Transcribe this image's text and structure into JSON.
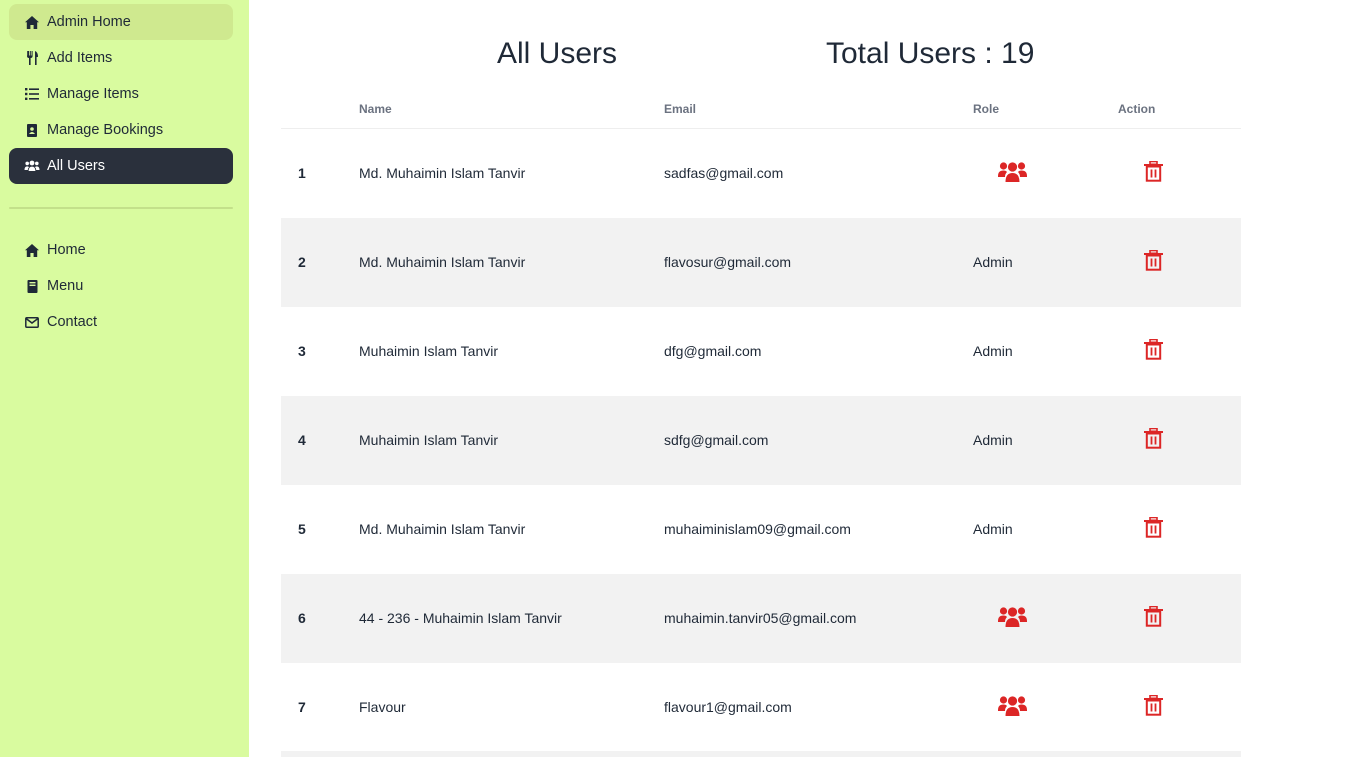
{
  "sidebar": {
    "items": [
      {
        "label": "Admin Home",
        "icon": "home-icon"
      },
      {
        "label": "Add Items",
        "icon": "utensils-icon"
      },
      {
        "label": "Manage Items",
        "icon": "list-icon"
      },
      {
        "label": "Manage Bookings",
        "icon": "book-icon"
      },
      {
        "label": "All Users",
        "icon": "users-icon"
      }
    ],
    "bottom_items": [
      {
        "label": "Home",
        "icon": "home-icon"
      },
      {
        "label": "Menu",
        "icon": "menu-book-icon"
      },
      {
        "label": "Contact",
        "icon": "mail-icon"
      }
    ]
  },
  "header": {
    "title": "All Users",
    "total": "Total Users : 19"
  },
  "table": {
    "columns": [
      "Name",
      "Email",
      "Role",
      "Action"
    ],
    "rows": [
      {
        "index": "1",
        "name": "Md. Muhaimin Islam Tanvir",
        "email": "sadfas@gmail.com",
        "role": ""
      },
      {
        "index": "2",
        "name": "Md. Muhaimin Islam Tanvir",
        "email": "flavosur@gmail.com",
        "role": "Admin"
      },
      {
        "index": "3",
        "name": "Muhaimin Islam Tanvir",
        "email": "dfg@gmail.com",
        "role": "Admin"
      },
      {
        "index": "4",
        "name": "Muhaimin Islam Tanvir",
        "email": "sdfg@gmail.com",
        "role": "Admin"
      },
      {
        "index": "5",
        "name": "Md. Muhaimin Islam Tanvir",
        "email": "muhaiminislam09@gmail.com",
        "role": "Admin"
      },
      {
        "index": "6",
        "name": "44 - 236 - Muhaimin Islam Tanvir",
        "email": "muhaimin.tanvir05@gmail.com",
        "role": ""
      },
      {
        "index": "7",
        "name": "Flavour",
        "email": "flavour1@gmail.com",
        "role": ""
      }
    ]
  },
  "colors": {
    "sidebar_bg": "#d9fb9f",
    "active_bg": "#2a303c",
    "danger": "#dc2626",
    "row_alt": "#f2f2f2"
  }
}
